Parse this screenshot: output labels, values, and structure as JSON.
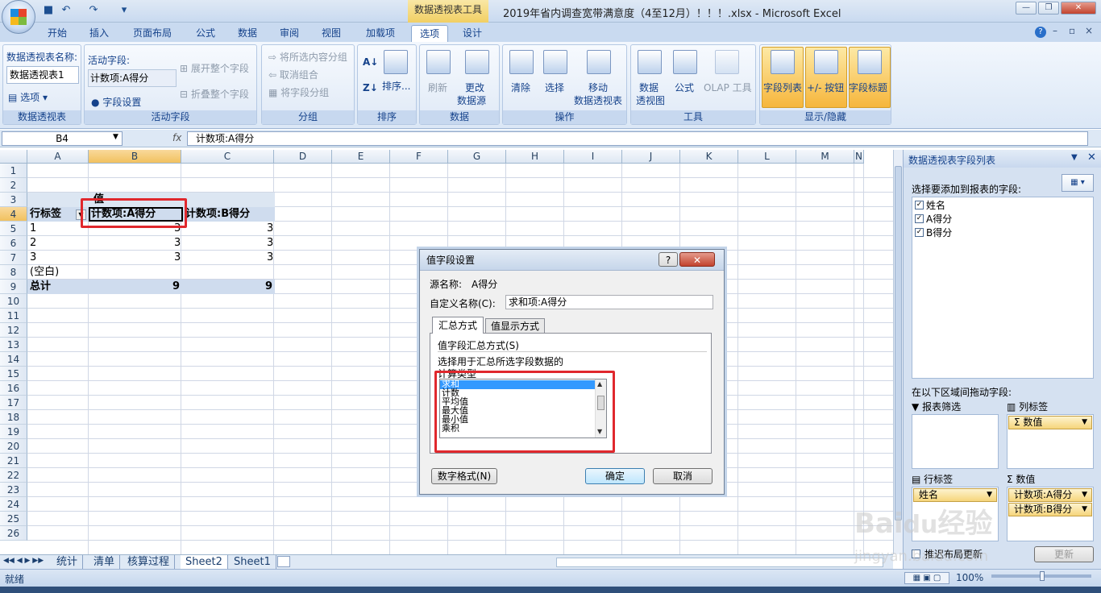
{
  "window": {
    "title": "2019年省内调查宽带满意度（4至12月）！！！.xlsx - Microsoft Excel",
    "context_tab": "数据透视表工具"
  },
  "tabs": [
    "开始",
    "插入",
    "页面布局",
    "公式",
    "数据",
    "审阅",
    "视图",
    "加载项",
    "选项",
    "设计"
  ],
  "ribbon": {
    "pivot_name_label": "数据透视表名称:",
    "pivot_name": "数据透视表1",
    "options_label": "选项",
    "group1": "数据透视表",
    "active_field_label": "活动字段:",
    "active_field": "计数项:A得分",
    "field_settings": "字段设置",
    "expand": "展开整个字段",
    "collapse": "折叠整个字段",
    "group2": "活动字段",
    "group_sel": "将所选内容分组",
    "ungroup": "取消组合",
    "group_field": "将字段分组",
    "group3": "分组",
    "sort": "排序...",
    "group4": "排序",
    "refresh": "刷新",
    "change_src1": "更改",
    "change_src2": "数据源",
    "group5": "数据",
    "clear": "清除",
    "select": "选择",
    "move1": "移动",
    "move2": "数据透视表",
    "group6": "操作",
    "pivotchart1": "数据",
    "pivotchart2": "透视图",
    "formula": "公式",
    "olap": "OLAP 工具",
    "group7": "工具",
    "field_list": "字段列表",
    "buttons": "+/- 按钮",
    "headers": "字段标题",
    "group8": "显示/隐藏"
  },
  "formula_bar": {
    "cell": "B4",
    "fx": "fx",
    "content": "计数项:A得分"
  },
  "sheet": {
    "columns": [
      "A",
      "B",
      "C",
      "D",
      "E",
      "F",
      "G",
      "H",
      "I",
      "J",
      "K",
      "L",
      "M",
      "N"
    ],
    "rows": [
      "1",
      "2",
      "3",
      "4",
      "5",
      "6",
      "7",
      "8",
      "9",
      "10",
      "11",
      "12",
      "13",
      "14",
      "15",
      "16",
      "17",
      "18",
      "19",
      "20",
      "21",
      "22",
      "23",
      "24",
      "25",
      "26"
    ],
    "r3b": "值",
    "r4a": "行标签",
    "r4b": "计数项:A得分",
    "r4c": "计数项:B得分",
    "data": [
      [
        "1",
        "3",
        "3"
      ],
      [
        "2",
        "3",
        "3"
      ],
      [
        "3",
        "3",
        "3"
      ]
    ],
    "blank": "(空白)",
    "total": "总计",
    "total_b": "9",
    "total_c": "9"
  },
  "sheet_tabs": [
    "统计",
    "清单",
    "核算过程",
    "Sheet2",
    "Sheet1"
  ],
  "status": {
    "ready": "就绪",
    "zoom": "100%"
  },
  "panel": {
    "title": "数据透视表字段列表",
    "choose": "选择要添加到报表的字段:",
    "fields": [
      "姓名",
      "A得分",
      "B得分"
    ],
    "drag": "在以下区域间拖动字段:",
    "filter": "报表筛选",
    "col": "列标签",
    "col_item": "Σ 数值",
    "row": "行标签",
    "values": "数值",
    "row_item": "姓名",
    "val_items": [
      "计数项:A得分",
      "计数项:B得分"
    ],
    "defer": "推迟布局更新",
    "update": "更新"
  },
  "dialog": {
    "title": "值字段设置",
    "help": "?",
    "source_label": "源名称:",
    "source": "A得分",
    "custom_label": "自定义名称(C):",
    "custom": "求和项:A得分",
    "tab1": "汇总方式",
    "tab2": "值显示方式",
    "section": "值字段汇总方式(S)",
    "desc1": "选择用于汇总所选字段数据的",
    "desc2": "计算类型",
    "list": [
      "求和",
      "计数",
      "平均值",
      "最大值",
      "最小值",
      "乘积"
    ],
    "numfmt": "数字格式(N)",
    "ok": "确定",
    "cancel": "取消"
  },
  "watermark": "Baidu经验 jingyan.baidu.com"
}
